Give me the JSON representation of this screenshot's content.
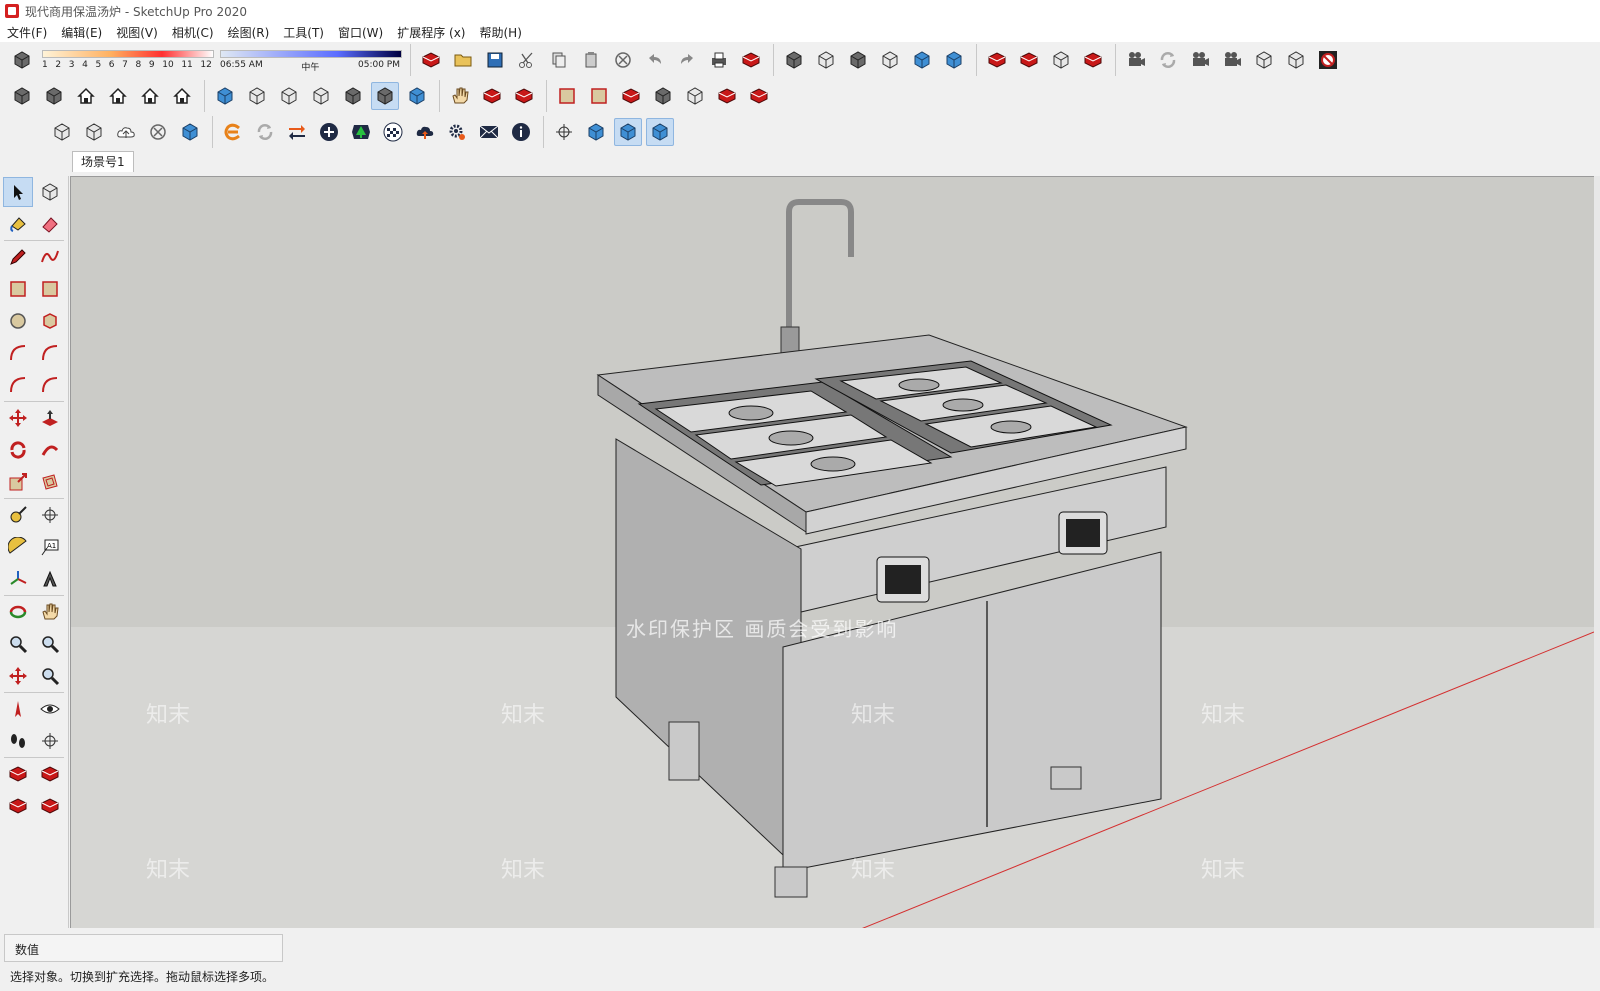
{
  "window": {
    "title": "现代商用保温汤炉 - SketchUp Pro 2020"
  },
  "menu": [
    {
      "label": "文件(F)"
    },
    {
      "label": "编辑(E)"
    },
    {
      "label": "视图(V)"
    },
    {
      "label": "相机(C)"
    },
    {
      "label": "绘图(R)"
    },
    {
      "label": "工具(T)"
    },
    {
      "label": "窗口(W)"
    },
    {
      "label": "扩展程序 (x)"
    },
    {
      "label": "帮助(H)"
    }
  ],
  "shadows": {
    "months": [
      "1",
      "2",
      "3",
      "4",
      "5",
      "6",
      "7",
      "8",
      "9",
      "10",
      "11",
      "12"
    ],
    "time_start": "06:55 AM",
    "time_mid": "中午",
    "time_end": "05:00 PM"
  },
  "scene_tab": {
    "label": "场景号1"
  },
  "viewport": {
    "watermark_text": "水印保护区   画质会受到影响",
    "watermark_logo": "知末"
  },
  "status": {
    "vcb_label": "数值",
    "hint": "选择对象。切换到扩充选择。拖动鼠标选择多项。"
  },
  "colors": {
    "accent": "#d42020",
    "active_tool": "#c6dcf3",
    "viewport_bg": "#cbcbc7"
  }
}
